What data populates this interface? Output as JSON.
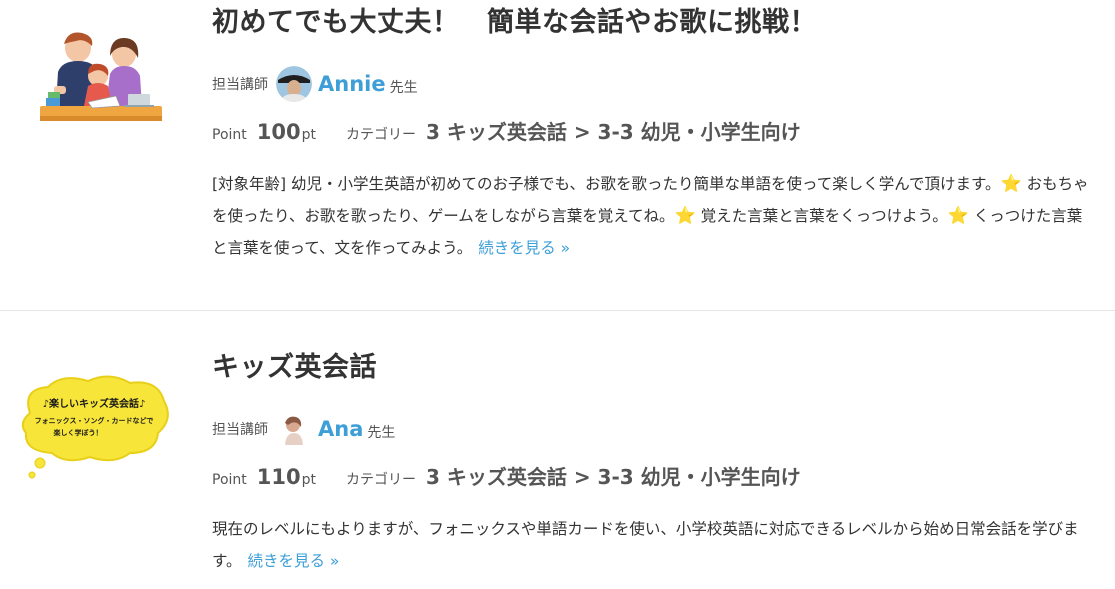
{
  "lessons": [
    {
      "title": "初めてでも大丈夫！　簡単な会話やお歌に挑戦！",
      "instructor_label": "担当講師",
      "teacher_name": "Annie",
      "teacher_suffix": "先生",
      "point_label": "Point",
      "point_value": "100",
      "point_unit": "pt",
      "category_label": "カテゴリー",
      "category_value": "3 キッズ英会話 > 3-3 幼児・小学生向け",
      "description_parts": [
        "[対象年齢] 幼児・小学生英語が初めてのお子様でも、お歌を歌ったり簡単な単語を使って楽しく学んで頂けます。",
        " おもちゃを使ったり、お歌を歌ったり、ゲームをしながら言葉を覚えてね。",
        " 覚えた言葉と言葉をくっつけよう。",
        " くっつけた言葉と言葉を使って、文を作ってみよう。"
      ],
      "more_label": "続きを見る »"
    },
    {
      "title": "キッズ英会話",
      "instructor_label": "担当講師",
      "teacher_name": "Ana",
      "teacher_suffix": "先生",
      "point_label": "Point",
      "point_value": "110",
      "point_unit": "pt",
      "category_label": "カテゴリー",
      "category_value": "3 キッズ英会話 > 3-3 幼児・小学生向け",
      "description": "現在のレベルにもよりますが、フォニックスや単語カードを使い、小学校英語に対応できるレベルから始め日常会話を学びます。",
      "more_label": "続きを見る »",
      "thumbnail_text": [
        "♪楽しいキッズ英会話♪",
        "フォニックス・ソング・カードなどで",
        "楽しく学ぼう！"
      ]
    }
  ],
  "icons": {
    "star": "star-icon"
  },
  "colors": {
    "link": "#3e9fd8",
    "thumb_bubble": "#f7e53a"
  }
}
